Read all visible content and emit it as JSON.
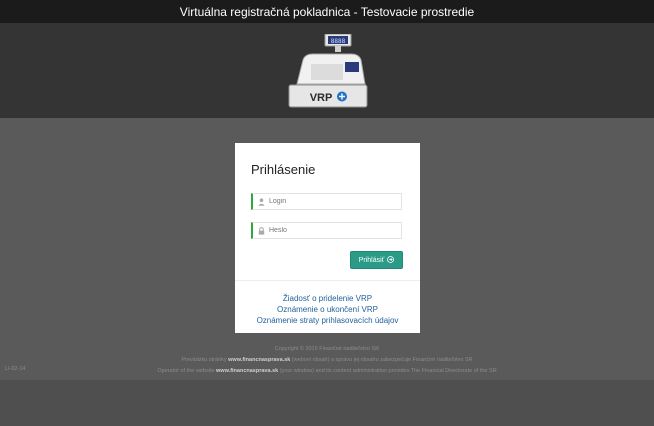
{
  "header": {
    "title": "Virtuálna registračná pokladnica - Testovacie prostredie"
  },
  "logo": {
    "text": "VRP",
    "display": "8888"
  },
  "login": {
    "title": "Prihlásenie",
    "login_placeholder": "Login",
    "password_placeholder": "Heslo",
    "submit_label": "Prihlásiť"
  },
  "links": [
    "Žiadosť o pridelenie VRP",
    "Oznámenie o ukončení VRP",
    "Oznámenie straty prihlasovacích údajov"
  ],
  "footer": {
    "copyright": "Copyright © 2015 Finančné riaditeľstvo SR",
    "line1_pre": "Prevádzku stránky ",
    "line1_link": "www.financnasprava.sk",
    "line1_post": " (weboví obsah) a správu jej obsahu zabezpečuje Finančné riaditeľstvo SR",
    "line2_pre": "Operator of the website ",
    "line2_link": "www.financnasprava.sk",
    "line2_post": " (your window) and its content administration provides The Financial Directorate of the SR"
  },
  "version": "LI-02-14",
  "colors": {
    "accent": "#2b9b88",
    "field_marker": "#2aaa3a",
    "link": "#1f5f9a"
  }
}
